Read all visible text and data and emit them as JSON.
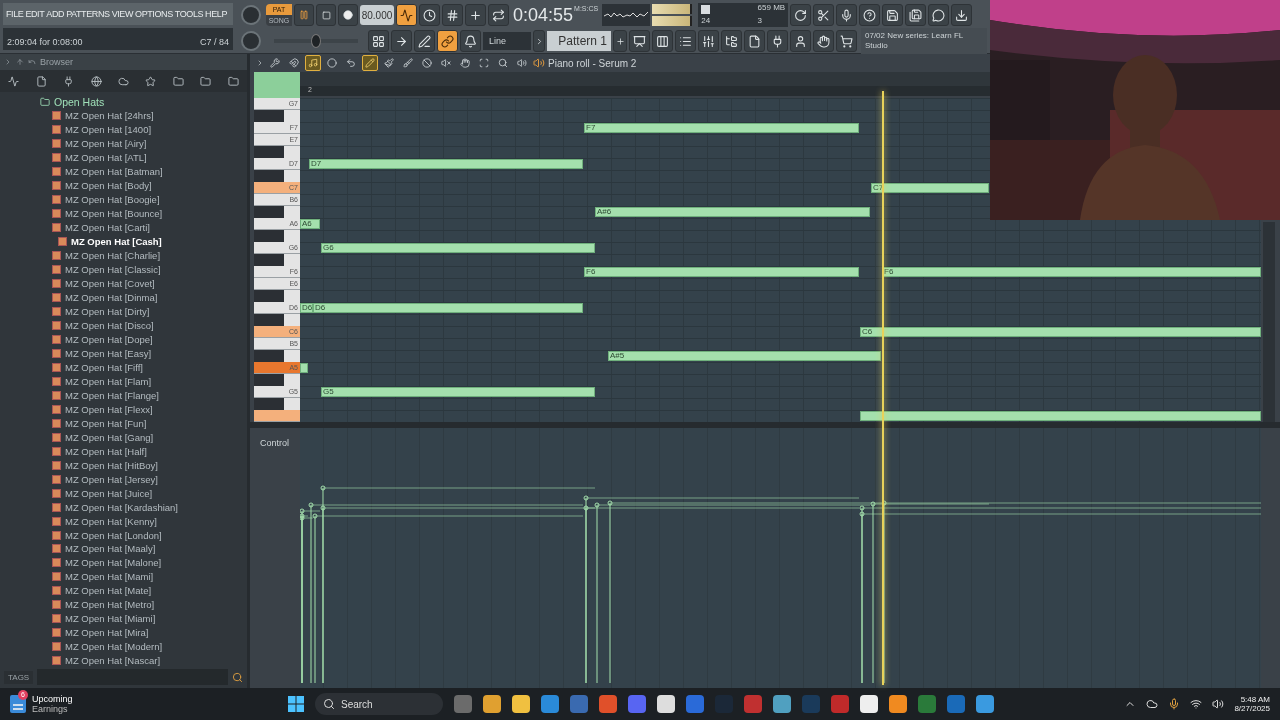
{
  "menu": [
    "FILE",
    "EDIT",
    "ADD",
    "PATTERNS",
    "VIEW",
    "OPTIONS",
    "TOOLS",
    "HELP"
  ],
  "hint": {
    "position": "2:09:04 for 0:08:00",
    "note": "C7 / 84"
  },
  "transport": {
    "modes": [
      {
        "label": "PAT",
        "selected": true
      },
      {
        "label": "SONG",
        "selected": false
      }
    ],
    "tempo": "80.000"
  },
  "recording_tools": [
    {
      "on": true
    },
    {
      "on": false
    },
    {
      "on": false
    },
    {
      "on": false
    },
    {
      "on": false
    }
  ],
  "time": {
    "value": "0:04:55",
    "unit": "M:S:CS"
  },
  "output_meter": {
    "left": {
      "level": 0.95
    },
    "right": {
      "level": 0.95
    }
  },
  "cpu": {
    "level": 0.15,
    "voices": "24",
    "memory": "659 MB",
    "polyphony": "3"
  },
  "master_pitch": {
    "level": 0.5
  },
  "snap_tools": [
    {
      "on": false
    },
    {
      "on": false
    },
    {
      "on": false
    },
    {
      "on": true
    },
    {
      "on": false
    }
  ],
  "snap": {
    "value": "Line"
  },
  "pattern": {
    "name": "Pattern 1"
  },
  "news": {
    "date": "07/02",
    "text": "New series: Learn FL Studio"
  },
  "browser": {
    "title": "Browser",
    "folder": "Open Hats",
    "tags_label": "TAGS",
    "items": [
      {
        "label": "MZ Open Hat [24hrs]",
        "selected": false
      },
      {
        "label": "MZ Open Hat [1400]",
        "selected": false
      },
      {
        "label": "MZ Open Hat [Airy]",
        "selected": false
      },
      {
        "label": "MZ Open Hat [ATL]",
        "selected": false
      },
      {
        "label": "MZ Open Hat [Batman]",
        "selected": false
      },
      {
        "label": "MZ Open Hat [Body]",
        "selected": false
      },
      {
        "label": "MZ Open Hat [Boogie]",
        "selected": false
      },
      {
        "label": "MZ Open Hat [Bounce]",
        "selected": false
      },
      {
        "label": "MZ Open Hat [Carti]",
        "selected": false
      },
      {
        "label": "MZ Open Hat [Cash]",
        "selected": true
      },
      {
        "label": "MZ Open Hat [Charlie]",
        "selected": false
      },
      {
        "label": "MZ Open Hat [Classic]",
        "selected": false
      },
      {
        "label": "MZ Open Hat [Covet]",
        "selected": false
      },
      {
        "label": "MZ Open Hat [Dinma]",
        "selected": false
      },
      {
        "label": "MZ Open Hat [Dirty]",
        "selected": false
      },
      {
        "label": "MZ Open Hat [Disco]",
        "selected": false
      },
      {
        "label": "MZ Open Hat [Dope]",
        "selected": false
      },
      {
        "label": "MZ Open Hat [Easy]",
        "selected": false
      },
      {
        "label": "MZ Open Hat [Fiff]",
        "selected": false
      },
      {
        "label": "MZ Open Hat [Flam]",
        "selected": false
      },
      {
        "label": "MZ Open Hat [Flange]",
        "selected": false
      },
      {
        "label": "MZ Open Hat [Flexx]",
        "selected": false
      },
      {
        "label": "MZ Open Hat [Fun]",
        "selected": false
      },
      {
        "label": "MZ Open Hat [Gang]",
        "selected": false
      },
      {
        "label": "MZ Open Hat [Half]",
        "selected": false
      },
      {
        "label": "MZ Open Hat [HitBoy]",
        "selected": false
      },
      {
        "label": "MZ Open Hat [Jersey]",
        "selected": false
      },
      {
        "label": "MZ Open Hat [Juice]",
        "selected": false
      },
      {
        "label": "MZ Open Hat [Kardashian]",
        "selected": false
      },
      {
        "label": "MZ Open Hat [Kenny]",
        "selected": false
      },
      {
        "label": "MZ Open Hat [London]",
        "selected": false
      },
      {
        "label": "MZ Open Hat [Maaly]",
        "selected": false
      },
      {
        "label": "MZ Open Hat [Malone]",
        "selected": false
      },
      {
        "label": "MZ Open Hat [Mami]",
        "selected": false
      },
      {
        "label": "MZ Open Hat [Mate]",
        "selected": false
      },
      {
        "label": "MZ Open Hat [Metro]",
        "selected": false
      },
      {
        "label": "MZ Open Hat [Miami]",
        "selected": false
      },
      {
        "label": "MZ Open Hat [Mira]",
        "selected": false
      },
      {
        "label": "MZ Open Hat [Modern]",
        "selected": false
      },
      {
        "label": "MZ Open Hat [Nascar]",
        "selected": false
      }
    ]
  },
  "piano_roll": {
    "title": "Piano roll - Serum 2",
    "ruler": "2",
    "control_label": "Control",
    "tools": [
      {
        "on": false
      },
      {
        "on": false
      },
      {
        "on": true
      },
      {
        "on": false
      },
      {
        "on": false
      },
      {
        "on": true
      },
      {
        "on": false
      },
      {
        "on": false
      },
      {
        "on": false
      },
      {
        "on": false
      },
      {
        "on": false
      },
      {
        "on": false
      },
      {
        "on": false
      },
      {
        "on": false
      }
    ],
    "keys": [
      {
        "kind": "white",
        "label": "G7",
        "color": "#e4e4e4"
      },
      {
        "kind": "black",
        "color": "#2b2f34"
      },
      {
        "kind": "white",
        "label": "F7",
        "color": "#e4e4e4"
      },
      {
        "kind": "white",
        "label": "E7",
        "color": "#e4e4e4"
      },
      {
        "kind": "black",
        "color": "#2b2f34"
      },
      {
        "kind": "white",
        "label": "D7",
        "color": "#e4e4e4"
      },
      {
        "kind": "black",
        "color": "#2b2f34"
      },
      {
        "kind": "white",
        "label": "C7",
        "color": "#f4b07c"
      },
      {
        "kind": "white",
        "label": "B6",
        "color": "#e4e4e4"
      },
      {
        "kind": "black",
        "color": "#2b2f34"
      },
      {
        "kind": "white",
        "label": "A6",
        "color": "#e4e4e4"
      },
      {
        "kind": "black",
        "color": "#2b2f34"
      },
      {
        "kind": "white",
        "label": "G6",
        "color": "#e4e4e4"
      },
      {
        "kind": "black",
        "color": "#2b2f34"
      },
      {
        "kind": "white",
        "label": "F6",
        "color": "#e4e4e4"
      },
      {
        "kind": "white",
        "label": "E6",
        "color": "#e4e4e4"
      },
      {
        "kind": "black",
        "color": "#2b2f34"
      },
      {
        "kind": "white",
        "label": "D6",
        "color": "#e4e4e4"
      },
      {
        "kind": "black",
        "color": "#2b2f34"
      },
      {
        "kind": "white",
        "label": "C6",
        "color": "#f4b07c"
      },
      {
        "kind": "white",
        "label": "B5",
        "color": "#e4e4e4"
      },
      {
        "kind": "black",
        "color": "#2b2f34"
      },
      {
        "kind": "white",
        "label": "A5",
        "color": "#e8772e"
      },
      {
        "kind": "black",
        "color": "#2b2f34"
      },
      {
        "kind": "white",
        "label": "G5",
        "color": "#e4e4e4"
      },
      {
        "kind": "black",
        "color": "#2b2f34"
      },
      {
        "kind": "white",
        "color": "#f4b07c"
      }
    ],
    "notes": [
      {
        "kind": "note",
        "label": "F7"
      },
      {
        "kind": "note",
        "label": "D7"
      },
      {
        "kind": "note",
        "label": "C7"
      },
      {
        "kind": "note",
        "label": "A#6"
      },
      {
        "kind": "note",
        "label": "A6"
      },
      {
        "kind": "note",
        "label": "G6"
      },
      {
        "kind": "note",
        "label": "F6"
      },
      {
        "kind": "note",
        "label": "F6"
      },
      {
        "kind": "note",
        "label": "D6"
      },
      {
        "kind": "note",
        "label": "D6"
      },
      {
        "kind": "note",
        "label": "C6"
      },
      {
        "kind": "note",
        "label": "A#5"
      },
      {
        "kind": "note"
      },
      {
        "kind": "note",
        "label": "G5"
      },
      {
        "kind": "note"
      }
    ]
  },
  "taskbar": {
    "widget": {
      "badge": "6",
      "title": "Upcoming",
      "subtitle": "Earnings"
    },
    "search": "Search",
    "time": "5:48 AM",
    "date": "8/27/2025"
  }
}
